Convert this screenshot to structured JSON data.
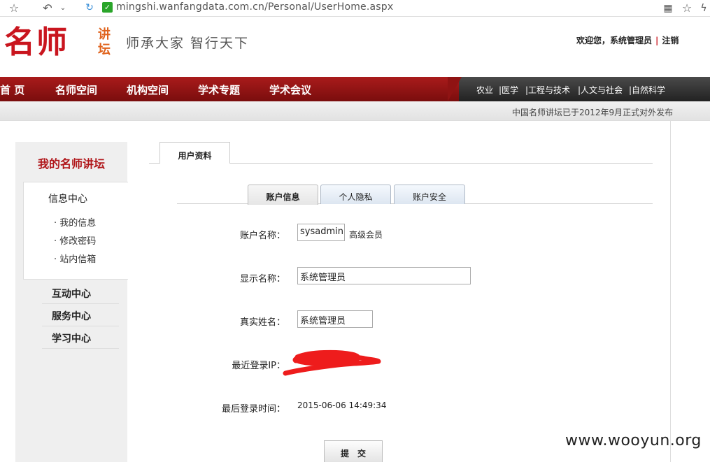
{
  "browser": {
    "url": "mingshi.wanfangdata.com.cn/Personal/UserHome.aspx",
    "lock_glyph": "✓"
  },
  "header": {
    "logo_main": "名师",
    "logo_small": "讲坛",
    "slogan": "师承大家  智行天下",
    "welcome_text": "欢迎您，系统管理员",
    "separator": "|",
    "logout": "注销"
  },
  "nav": {
    "items": [
      "首 页",
      "名师空间",
      "机构空间",
      "学术专题",
      "学术会议"
    ],
    "categories": [
      "农业",
      "|医学",
      "|工程与技术",
      "|人文与社会",
      "|自然科学"
    ],
    "announcement": "中国名师讲坛已于2012年9月正式对外发布"
  },
  "sidebar": {
    "title": "我的名师讲坛",
    "panel_title": "信息中心",
    "links": [
      "· 我的信息",
      "· 修改密码",
      "· 站内信箱"
    ],
    "sections": [
      "互动中心",
      "服务中心",
      "学习中心"
    ]
  },
  "main": {
    "tab": "用户资料",
    "subtabs": [
      "账户信息",
      "个人隐私",
      "账户安全"
    ],
    "fields": {
      "account_label": "账户名称：",
      "account_value": "sysadmin",
      "member_level": "高级会员",
      "display_label": "显示名称：",
      "display_value": "系统管理员",
      "realname_label": "真实姓名：",
      "realname_value": "系统管理员",
      "ip_label": "最近登录IP：",
      "time_label": "最后登录时间：",
      "time_value": "2015-06-06 14:49:34"
    },
    "submit": "提交"
  },
  "watermark": "www.wooyun.org",
  "colors": {
    "brand_red": "#c9151e",
    "accent_orange": "#e0631d",
    "redact_red": "#ee1c1c"
  }
}
